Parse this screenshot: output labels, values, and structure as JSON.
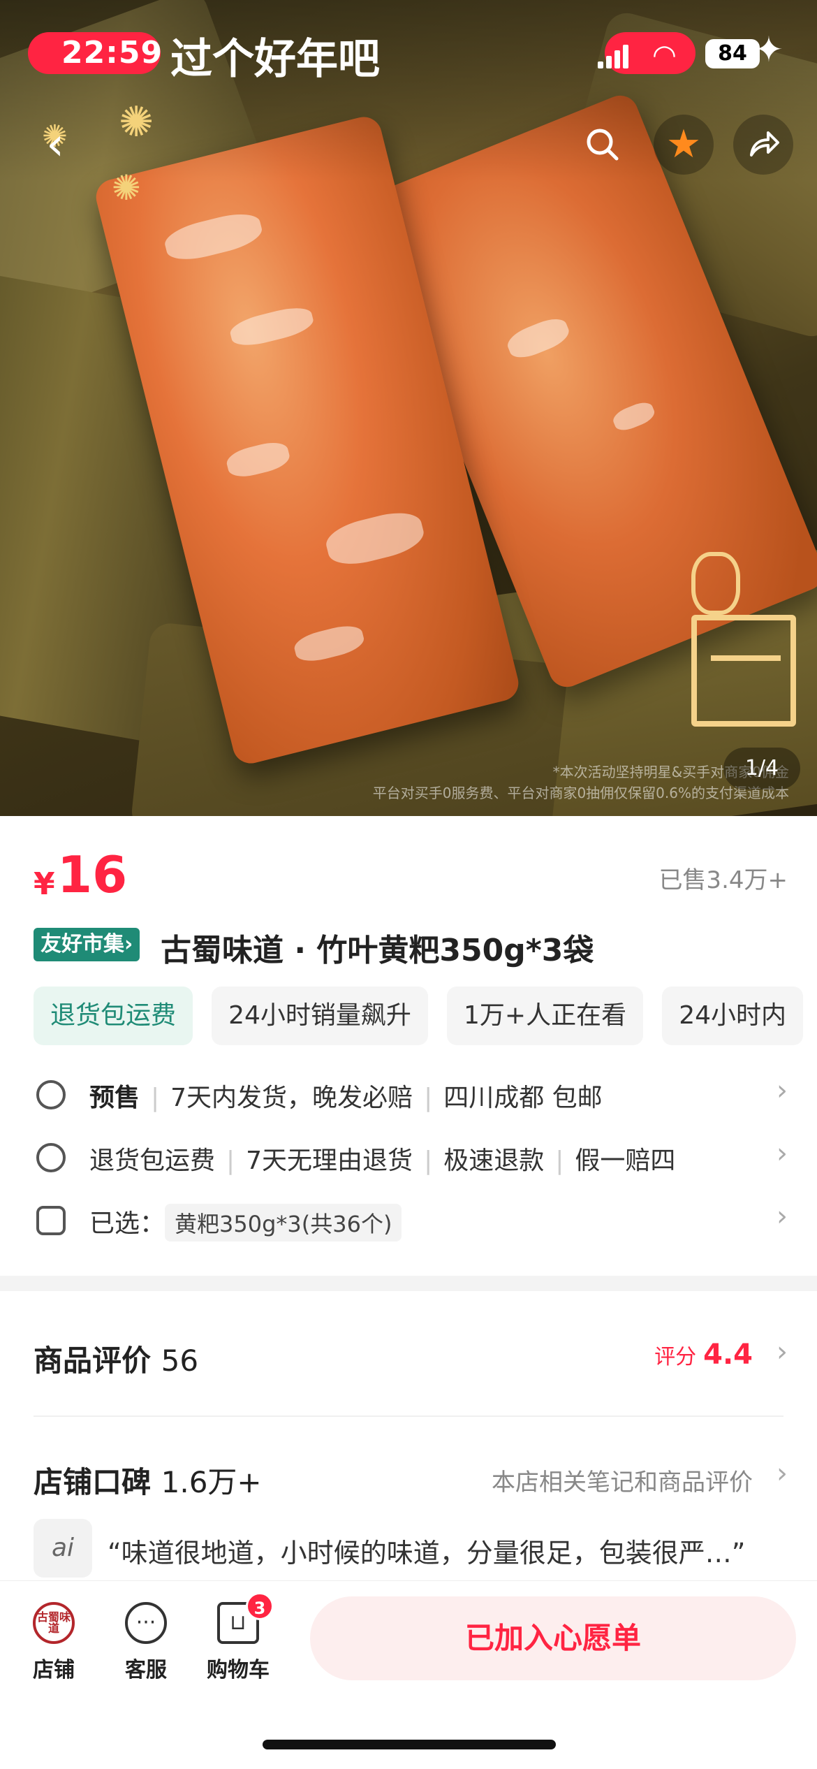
{
  "status_bar": {
    "time": "22:59",
    "banner": "过个好年吧",
    "battery": "84"
  },
  "hero": {
    "disclaimer_line1": "*本次活动坚持明星&买手对商家0佣金",
    "disclaimer_line2": "平台对买手0服务费、平台对商家0抽佣仅保留0.6%的支付渠道成本",
    "page_counter": "1/4"
  },
  "product": {
    "currency": "¥",
    "price": "16",
    "sold": "已售3.4万+",
    "market_badge": "友好市集›",
    "title": "古蜀味道 · 竹叶黄粑350g*3袋",
    "tags": [
      "退货包运费",
      "24小时销量飙升",
      "1万+人正在看",
      "24小时内"
    ]
  },
  "info": {
    "presale": "预售",
    "ship": "7天内发货，晚发必赔",
    "origin": "四川成都 包邮",
    "guarantee": [
      "退货包运费",
      "7天无理由退货",
      "极速退款",
      "假一赔四"
    ],
    "selected_label": "已选：",
    "selected_value": "黄粑350g*3(共36个)"
  },
  "reviews": {
    "title": "商品评价",
    "count": "56",
    "score_label": "评分",
    "score": "4.4"
  },
  "shop_reputation": {
    "title": "店铺口碑",
    "count": "1.6万+",
    "link": "本店相关笔记和商品评价",
    "ai_badge": "ai",
    "quote": "“味道很地道，小时候的味道，分量很足，包装很严…”"
  },
  "bottom_bar": {
    "shop_logo_text": "古蜀味道",
    "shop": "店铺",
    "service": "客服",
    "cart": "购物车",
    "cart_count": "3",
    "wishlist_button": "已加入心愿单"
  },
  "colors": {
    "accent": "#ff2442",
    "market_green": "#1f8b76"
  }
}
